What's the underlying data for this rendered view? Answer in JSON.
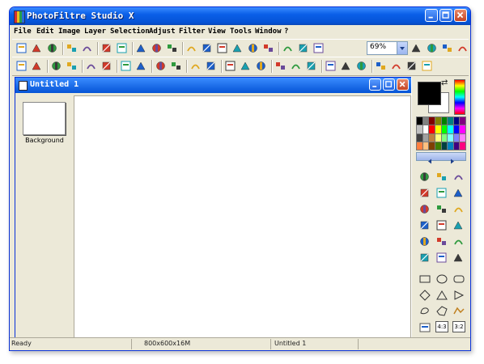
{
  "app": {
    "title": "PhotoFiltre Studio X"
  },
  "menu": [
    "File",
    "Edit",
    "Image",
    "Layer",
    "Selection",
    "Adjust",
    "Filter",
    "View",
    "Tools",
    "Window",
    "?"
  ],
  "toolbar": {
    "zoom": "69%",
    "row1_icons": [
      "new-file-icon",
      "open-folder-icon",
      "save-icon",
      "print-icon",
      "scan-icon",
      "undo-icon",
      "redo-icon",
      "copy-icon",
      "paste-icon",
      "paste-as-image-icon",
      "crop-icon",
      "histogram-icon",
      "filter-icon",
      "image-size-icon",
      "canvas-size-icon",
      "text-icon",
      "automate-icon",
      "palette-icon",
      "browser-icon",
      "zoom-in-icon",
      "zoom-out-icon",
      "fit-icon",
      "actual-size-icon"
    ],
    "row2_icons": [
      "gamma-auto-icon",
      "contrast-auto-icon",
      "brightness-minus-icon",
      "brightness-plus-icon",
      "contrast-minus-icon",
      "contrast-plus-icon",
      "gamma-minus-icon",
      "gamma-plus-icon",
      "saturation-minus-icon",
      "saturation-plus-icon",
      "levels-icon",
      "balance-icon",
      "grayscale-icon",
      "sepia-icon",
      "negative-icon",
      "blur-icon",
      "sharpen-icon",
      "soften-icon",
      "triangle-icon",
      "triangle-filled-icon",
      "gradient-icon",
      "texture-icon",
      "frame-icon",
      "flip-horizontal-icon",
      "flip-vertical-icon"
    ]
  },
  "document": {
    "title": "Untitled 1"
  },
  "layers": [
    {
      "name": "Background"
    }
  ],
  "colors": {
    "foreground": "#000000",
    "background": "#ffffff",
    "accent": "#0553d6"
  },
  "palette": [
    "#000000",
    "#808080",
    "#800000",
    "#808000",
    "#008000",
    "#008080",
    "#000080",
    "#800080",
    "#c0c0c0",
    "#ffffff",
    "#ff0000",
    "#ffff00",
    "#00ff00",
    "#00ffff",
    "#0000ff",
    "#ff00ff",
    "#404040",
    "#a0a0a0",
    "#c08040",
    "#ffff80",
    "#80ff80",
    "#80ffff",
    "#8080ff",
    "#ff80ff",
    "#ff8040",
    "#ffc080",
    "#804000",
    "#408000",
    "#004040",
    "#0080c0",
    "#400080",
    "#ff0080"
  ],
  "tools": [
    "selection-arrow-icon",
    "gradient-selection-icon",
    "hand-icon",
    "color-picker-icon",
    "magic-wand-icon",
    "line-icon",
    "fill-bucket-icon",
    "spray-icon",
    "eraser-icon",
    "brush-icon",
    "advanced-brush-icon",
    "stamp-icon",
    "blur-drop-icon",
    "smudge-icon",
    "clone-icon",
    "pattern-icon",
    "portrait-icon",
    "strawberry-icon",
    "rectangle-shape-icon",
    "ellipse-shape-icon",
    "rounded-rect-shape-icon",
    "diamond-shape-icon",
    "triangle-shape-icon",
    "arrow-shape-icon",
    "lasso-icon",
    "polygon-lasso-icon",
    "open-shape-icon",
    "fixed-size-icon",
    "ratio-43-icon",
    "ratio-32-icon"
  ],
  "tool_labels": {
    "ratio_43": "4:3",
    "ratio_32": "3:2"
  },
  "status": {
    "state": "Ready",
    "size": "800x600x16M",
    "file": "Untitled 1"
  }
}
